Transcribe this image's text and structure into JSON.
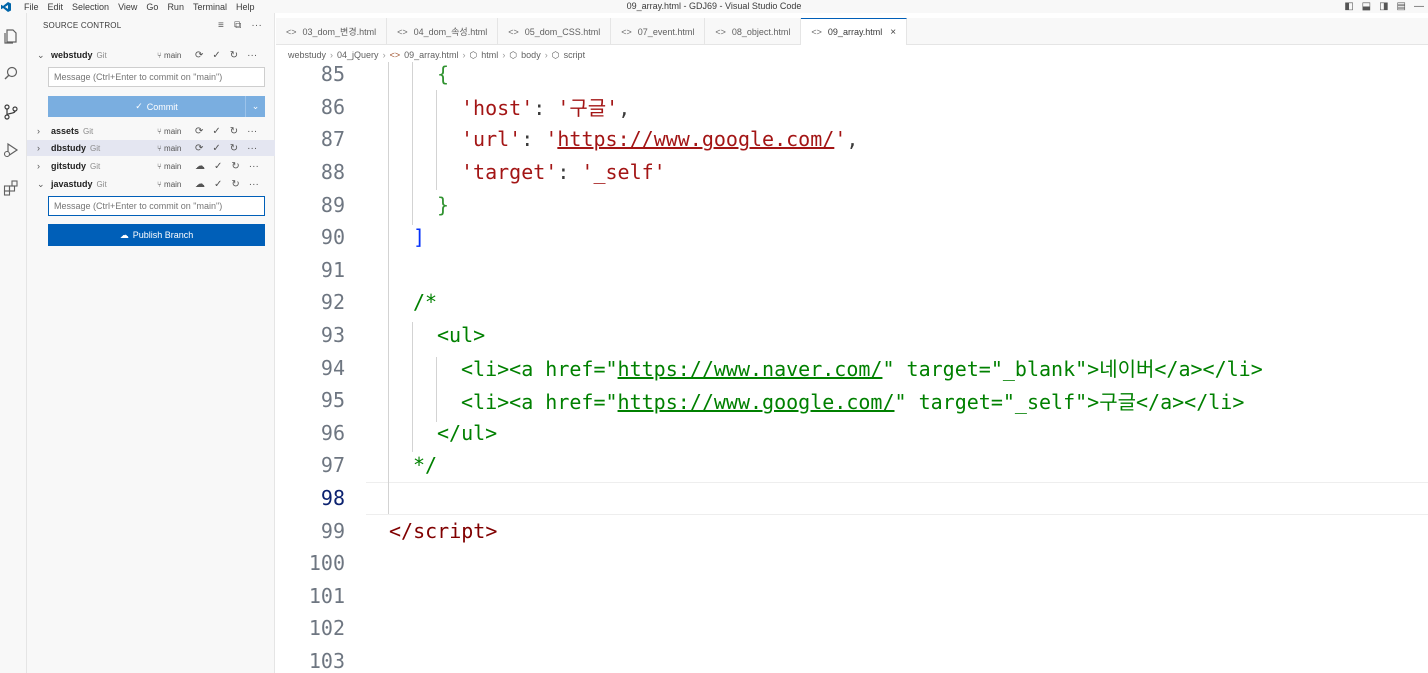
{
  "menu": [
    "File",
    "Edit",
    "Selection",
    "View",
    "Go",
    "Run",
    "Terminal",
    "Help"
  ],
  "window_title": "09_array.html - GDJ69 - Visual Studio Code",
  "sidebar": {
    "header": "SOURCE CONTROL",
    "commit_placeholder": "Message (Ctrl+Enter to commit on \"main\")",
    "commit_label": "Commit",
    "publish_label": "Publish Branch",
    "repos": [
      {
        "name": "webstudy",
        "vcs": "Git",
        "branch": "main"
      },
      {
        "name": "assets",
        "vcs": "Git",
        "branch": "main"
      },
      {
        "name": "dbstudy",
        "vcs": "Git",
        "branch": "main"
      },
      {
        "name": "gitstudy",
        "vcs": "Git",
        "branch": "main"
      },
      {
        "name": "javastudy",
        "vcs": "Git",
        "branch": "main"
      }
    ]
  },
  "tabs": [
    {
      "label": "03_dom_변경.html"
    },
    {
      "label": "04_dom_속성.html"
    },
    {
      "label": "05_dom_CSS.html"
    },
    {
      "label": "07_event.html"
    },
    {
      "label": "08_object.html"
    },
    {
      "label": "09_array.html",
      "active": true
    }
  ],
  "breadcrumb": [
    "webstudy",
    "04_jQuery",
    "09_array.html",
    "html",
    "body",
    "script"
  ],
  "editor": {
    "current_line": "98",
    "line_numbers": [
      "85",
      "86",
      "87",
      "88",
      "89",
      "90",
      "91",
      "92",
      "93",
      "94",
      "95",
      "96",
      "97",
      "98",
      "99",
      "100",
      "101",
      "102",
      "103"
    ],
    "colors": {
      "string": "#a31515",
      "comment": "#008000",
      "tag": "#800000",
      "bracket": "#0431fa",
      "brace": "#319331"
    }
  },
  "colors": {
    "accent": "#005fb8",
    "commit_disabled": "#7aaee0"
  }
}
